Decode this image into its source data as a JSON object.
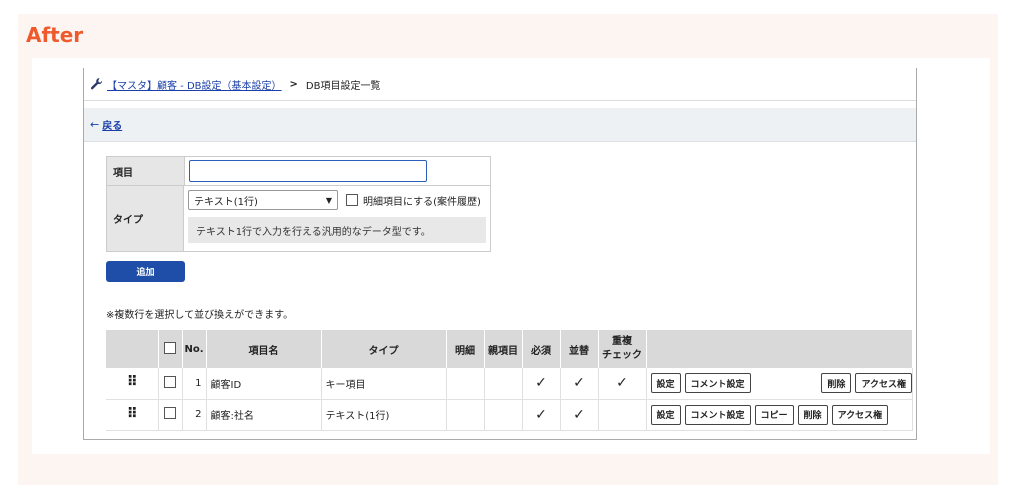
{
  "label": "After",
  "breadcrumb": {
    "icon": "wrench-icon",
    "link": "【マスタ】顧客 - DB設定（基本設定）",
    "separator": ">",
    "current": "DB項目設定一覧"
  },
  "back": {
    "arrow": "←",
    "label": "戻る"
  },
  "form": {
    "item_label": "項目",
    "item_value": "",
    "type_label": "タイプ",
    "type_selected": "テキスト(1行)",
    "detail_checkbox_label": "明細項目にする(案件履歴)",
    "type_description": "テキスト1行で入力を行える汎用的なデータ型です。"
  },
  "add_button": "追加",
  "note": "※複数行を選択して並び換えができます。",
  "table": {
    "headers": {
      "no": "No.",
      "name": "項目名",
      "type": "タイプ",
      "detail": "明細",
      "parent": "親項目",
      "required": "必須",
      "sort": "並替",
      "dup_line1": "重複",
      "dup_line2": "チェック"
    },
    "rows": [
      {
        "no": "1",
        "name": "顧客ID",
        "type": "キー項目",
        "required": "✓",
        "sort": "✓",
        "dup": "✓",
        "buttons": {
          "settings": "設定",
          "comment": "コメント設定",
          "delete": "削除",
          "access": "アクセス権"
        }
      },
      {
        "no": "2",
        "name": "顧客:社名",
        "type": "テキスト(1行)",
        "required": "✓",
        "sort": "✓",
        "dup": "",
        "buttons": {
          "settings": "設定",
          "comment": "コメント設定",
          "copy": "コピー",
          "delete": "削除",
          "access": "アクセス権"
        }
      }
    ]
  },
  "colors": {
    "accent": "#ee5a2b",
    "primary": "#1f4ea8",
    "link": "#1a3fa8"
  }
}
